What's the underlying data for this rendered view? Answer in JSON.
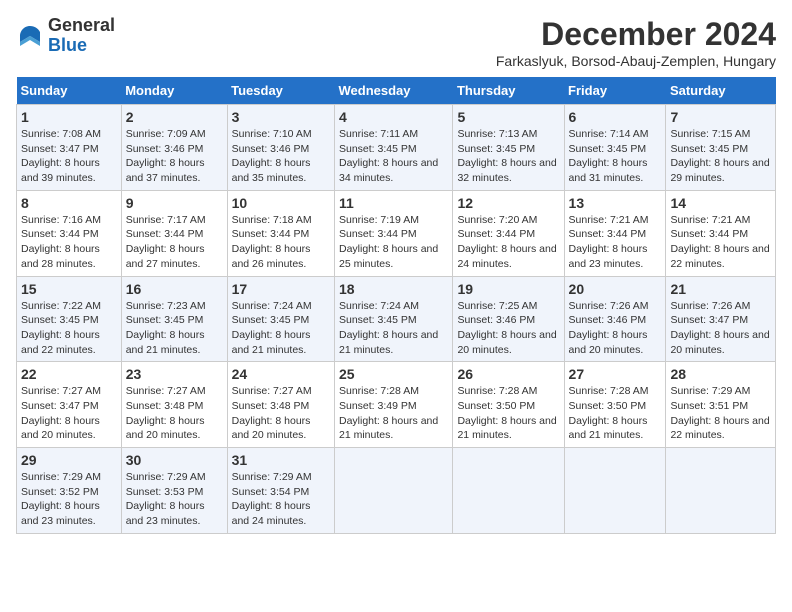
{
  "logo": {
    "general": "General",
    "blue": "Blue"
  },
  "title": "December 2024",
  "subtitle": "Farkaslyuk, Borsod-Abauj-Zemplen, Hungary",
  "headers": [
    "Sunday",
    "Monday",
    "Tuesday",
    "Wednesday",
    "Thursday",
    "Friday",
    "Saturday"
  ],
  "weeks": [
    [
      {
        "day": "1",
        "rise": "Sunrise: 7:08 AM",
        "set": "Sunset: 3:47 PM",
        "daylight": "Daylight: 8 hours and 39 minutes."
      },
      {
        "day": "2",
        "rise": "Sunrise: 7:09 AM",
        "set": "Sunset: 3:46 PM",
        "daylight": "Daylight: 8 hours and 37 minutes."
      },
      {
        "day": "3",
        "rise": "Sunrise: 7:10 AM",
        "set": "Sunset: 3:46 PM",
        "daylight": "Daylight: 8 hours and 35 minutes."
      },
      {
        "day": "4",
        "rise": "Sunrise: 7:11 AM",
        "set": "Sunset: 3:45 PM",
        "daylight": "Daylight: 8 hours and 34 minutes."
      },
      {
        "day": "5",
        "rise": "Sunrise: 7:13 AM",
        "set": "Sunset: 3:45 PM",
        "daylight": "Daylight: 8 hours and 32 minutes."
      },
      {
        "day": "6",
        "rise": "Sunrise: 7:14 AM",
        "set": "Sunset: 3:45 PM",
        "daylight": "Daylight: 8 hours and 31 minutes."
      },
      {
        "day": "7",
        "rise": "Sunrise: 7:15 AM",
        "set": "Sunset: 3:45 PM",
        "daylight": "Daylight: 8 hours and 29 minutes."
      }
    ],
    [
      {
        "day": "8",
        "rise": "Sunrise: 7:16 AM",
        "set": "Sunset: 3:44 PM",
        "daylight": "Daylight: 8 hours and 28 minutes."
      },
      {
        "day": "9",
        "rise": "Sunrise: 7:17 AM",
        "set": "Sunset: 3:44 PM",
        "daylight": "Daylight: 8 hours and 27 minutes."
      },
      {
        "day": "10",
        "rise": "Sunrise: 7:18 AM",
        "set": "Sunset: 3:44 PM",
        "daylight": "Daylight: 8 hours and 26 minutes."
      },
      {
        "day": "11",
        "rise": "Sunrise: 7:19 AM",
        "set": "Sunset: 3:44 PM",
        "daylight": "Daylight: 8 hours and 25 minutes."
      },
      {
        "day": "12",
        "rise": "Sunrise: 7:20 AM",
        "set": "Sunset: 3:44 PM",
        "daylight": "Daylight: 8 hours and 24 minutes."
      },
      {
        "day": "13",
        "rise": "Sunrise: 7:21 AM",
        "set": "Sunset: 3:44 PM",
        "daylight": "Daylight: 8 hours and 23 minutes."
      },
      {
        "day": "14",
        "rise": "Sunrise: 7:21 AM",
        "set": "Sunset: 3:44 PM",
        "daylight": "Daylight: 8 hours and 22 minutes."
      }
    ],
    [
      {
        "day": "15",
        "rise": "Sunrise: 7:22 AM",
        "set": "Sunset: 3:45 PM",
        "daylight": "Daylight: 8 hours and 22 minutes."
      },
      {
        "day": "16",
        "rise": "Sunrise: 7:23 AM",
        "set": "Sunset: 3:45 PM",
        "daylight": "Daylight: 8 hours and 21 minutes."
      },
      {
        "day": "17",
        "rise": "Sunrise: 7:24 AM",
        "set": "Sunset: 3:45 PM",
        "daylight": "Daylight: 8 hours and 21 minutes."
      },
      {
        "day": "18",
        "rise": "Sunrise: 7:24 AM",
        "set": "Sunset: 3:45 PM",
        "daylight": "Daylight: 8 hours and 21 minutes."
      },
      {
        "day": "19",
        "rise": "Sunrise: 7:25 AM",
        "set": "Sunset: 3:46 PM",
        "daylight": "Daylight: 8 hours and 20 minutes."
      },
      {
        "day": "20",
        "rise": "Sunrise: 7:26 AM",
        "set": "Sunset: 3:46 PM",
        "daylight": "Daylight: 8 hours and 20 minutes."
      },
      {
        "day": "21",
        "rise": "Sunrise: 7:26 AM",
        "set": "Sunset: 3:47 PM",
        "daylight": "Daylight: 8 hours and 20 minutes."
      }
    ],
    [
      {
        "day": "22",
        "rise": "Sunrise: 7:27 AM",
        "set": "Sunset: 3:47 PM",
        "daylight": "Daylight: 8 hours and 20 minutes."
      },
      {
        "day": "23",
        "rise": "Sunrise: 7:27 AM",
        "set": "Sunset: 3:48 PM",
        "daylight": "Daylight: 8 hours and 20 minutes."
      },
      {
        "day": "24",
        "rise": "Sunrise: 7:27 AM",
        "set": "Sunset: 3:48 PM",
        "daylight": "Daylight: 8 hours and 20 minutes."
      },
      {
        "day": "25",
        "rise": "Sunrise: 7:28 AM",
        "set": "Sunset: 3:49 PM",
        "daylight": "Daylight: 8 hours and 21 minutes."
      },
      {
        "day": "26",
        "rise": "Sunrise: 7:28 AM",
        "set": "Sunset: 3:50 PM",
        "daylight": "Daylight: 8 hours and 21 minutes."
      },
      {
        "day": "27",
        "rise": "Sunrise: 7:28 AM",
        "set": "Sunset: 3:50 PM",
        "daylight": "Daylight: 8 hours and 21 minutes."
      },
      {
        "day": "28",
        "rise": "Sunrise: 7:29 AM",
        "set": "Sunset: 3:51 PM",
        "daylight": "Daylight: 8 hours and 22 minutes."
      }
    ],
    [
      {
        "day": "29",
        "rise": "Sunrise: 7:29 AM",
        "set": "Sunset: 3:52 PM",
        "daylight": "Daylight: 8 hours and 23 minutes."
      },
      {
        "day": "30",
        "rise": "Sunrise: 7:29 AM",
        "set": "Sunset: 3:53 PM",
        "daylight": "Daylight: 8 hours and 23 minutes."
      },
      {
        "day": "31",
        "rise": "Sunrise: 7:29 AM",
        "set": "Sunset: 3:54 PM",
        "daylight": "Daylight: 8 hours and 24 minutes."
      },
      null,
      null,
      null,
      null
    ]
  ]
}
